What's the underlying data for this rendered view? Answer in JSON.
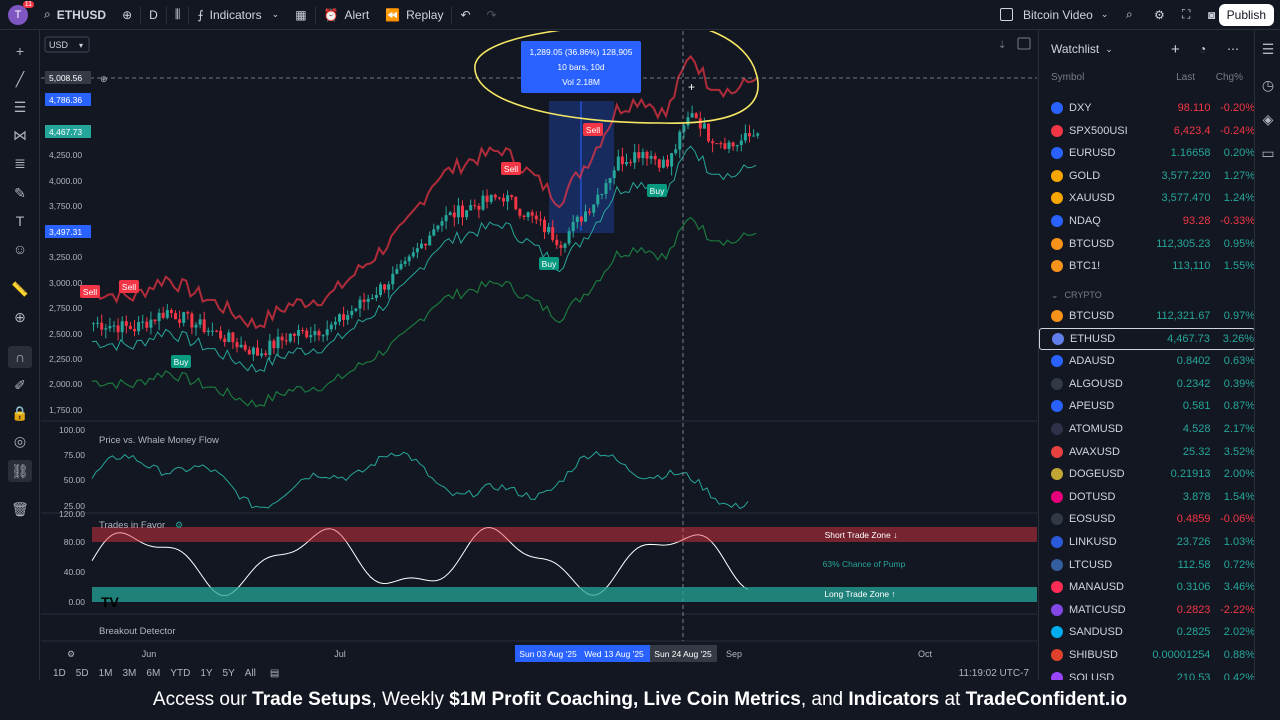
{
  "topbar": {
    "avatar_letter": "T",
    "avatar_badge": "11",
    "symbol": "ETHUSD",
    "interval": "D",
    "indicators_label": "Indicators",
    "alert_label": "Alert",
    "replay_label": "Replay",
    "layout_name": "Bitcoin Video",
    "publish_label": "Publish"
  },
  "chart": {
    "currency": "USD",
    "price_axis": [
      "5,008.56",
      "4,786.36",
      "4,467.73",
      "4,250.00",
      "4,000.00",
      "3,750.00",
      "3,497.31",
      "3,250.00",
      "3,000.00",
      "2,750.00",
      "2,500.00",
      "2,250.00",
      "2,000.00",
      "1,750.00"
    ],
    "measure_tooltip": {
      "line1": "1,289.05 (36.86%) 128,905",
      "line2": "10 bars, 10d",
      "line3": "Vol 2.18M"
    },
    "signals": [
      {
        "label": "Sell",
        "kind": "sell"
      },
      {
        "label": "Sell",
        "kind": "sell"
      },
      {
        "label": "Sell",
        "kind": "sell"
      },
      {
        "label": "Sell",
        "kind": "sell"
      },
      {
        "label": "Buy",
        "kind": "buy"
      },
      {
        "label": "Buy",
        "kind": "buy"
      },
      {
        "label": "Buy",
        "kind": "buy"
      }
    ],
    "pane2": {
      "title": "Price vs. Whale Money Flow",
      "axis": [
        "100.00",
        "75.00",
        "50.00",
        "25.00"
      ]
    },
    "pane3": {
      "title": "Trades in Favor",
      "axis": [
        "120.00",
        "80.00",
        "40.00",
        "0.00"
      ],
      "short_zone": "Short Trade Zone ↓",
      "pump_text": "63% Chance of Pump",
      "long_zone": "Long Trade Zone ↑"
    },
    "pane4": {
      "title": "Breakout Detector"
    },
    "time_axis": [
      "Jun",
      "Jul",
      "Sep",
      "Oct"
    ],
    "time_highlight": [
      "Sun 03 Aug '25",
      "Wed 13 Aug '25",
      "Sun 24 Aug '25"
    ],
    "ranges": [
      "1D",
      "5D",
      "1M",
      "3M",
      "6M",
      "YTD",
      "1Y",
      "5Y",
      "All"
    ],
    "clock": "11:19:02 UTC-7"
  },
  "watchlist": {
    "title": "Watchlist",
    "col_symbol": "Symbol",
    "col_last": "Last",
    "col_chg": "Chg%",
    "section": "CRYPTO",
    "rows_top": [
      {
        "sym": "DXY",
        "last": "98.110",
        "chg": "-0.20%",
        "dir": "dn",
        "color": "#2962ff"
      },
      {
        "sym": "SPX500USI",
        "last": "6,423.4",
        "chg": "-0.24%",
        "dir": "dn",
        "color": "#f23645"
      },
      {
        "sym": "EURUSD",
        "last": "1.16658",
        "chg": "0.20%",
        "dir": "up",
        "color": "#2962ff"
      },
      {
        "sym": "GOLD",
        "last": "3,577.220",
        "chg": "1.27%",
        "dir": "up",
        "color": "#f7a600"
      },
      {
        "sym": "XAUUSD",
        "last": "3,577.470",
        "chg": "1.24%",
        "dir": "up",
        "color": "#f7a600"
      },
      {
        "sym": "NDAQ",
        "last": "93.28",
        "chg": "-0.33%",
        "dir": "dn",
        "color": "#2962ff"
      },
      {
        "sym": "BTCUSD",
        "last": "112,305.23",
        "chg": "0.95%",
        "dir": "up",
        "color": "#f7931a"
      },
      {
        "sym": "BTC1!",
        "last": "113,110",
        "chg": "1.55%",
        "dir": "up",
        "color": "#f7931a"
      }
    ],
    "rows_crypto": [
      {
        "sym": "BTCUSD",
        "last": "112,321.67",
        "chg": "0.97%",
        "dir": "up",
        "color": "#f7931a"
      },
      {
        "sym": "ETHUSD",
        "last": "4,467.73",
        "chg": "3.26%",
        "dir": "up",
        "color": "#627eea"
      },
      {
        "sym": "ADAUSD",
        "last": "0.8402",
        "chg": "0.63%",
        "dir": "up",
        "color": "#2962ff"
      },
      {
        "sym": "ALGOUSD",
        "last": "0.2342",
        "chg": "0.39%",
        "dir": "up",
        "color": "#333a47"
      },
      {
        "sym": "APEUSD",
        "last": "0.581",
        "chg": "0.87%",
        "dir": "up",
        "color": "#2962ff"
      },
      {
        "sym": "ATOMUSD",
        "last": "4.528",
        "chg": "2.17%",
        "dir": "up",
        "color": "#2e3148"
      },
      {
        "sym": "AVAXUSD",
        "last": "25.32",
        "chg": "3.52%",
        "dir": "up",
        "color": "#e84142"
      },
      {
        "sym": "DOGEUSD",
        "last": "0.21913",
        "chg": "2.00%",
        "dir": "up",
        "color": "#c2a633"
      },
      {
        "sym": "DOTUSD",
        "last": "3.878",
        "chg": "1.54%",
        "dir": "up",
        "color": "#e6007a"
      },
      {
        "sym": "EOSUSD",
        "last": "0.4859",
        "chg": "-0.06%",
        "dir": "dn",
        "color": "#333a47"
      },
      {
        "sym": "LINKUSD",
        "last": "23.726",
        "chg": "1.03%",
        "dir": "up",
        "color": "#2a5ada"
      },
      {
        "sym": "LTCUSD",
        "last": "112.58",
        "chg": "0.72%",
        "dir": "up",
        "color": "#345d9d"
      },
      {
        "sym": "MANAUSD",
        "last": "0.3106",
        "chg": "3.46%",
        "dir": "up",
        "color": "#ff2d55"
      },
      {
        "sym": "MATICUSD",
        "last": "0.2823",
        "chg": "-2.22%",
        "dir": "dn",
        "color": "#8247e5"
      },
      {
        "sym": "SANDUSD",
        "last": "0.2825",
        "chg": "2.02%",
        "dir": "up",
        "color": "#00adef"
      },
      {
        "sym": "SHIBUSD",
        "last": "0.00001254",
        "chg": "0.88%",
        "dir": "up",
        "color": "#e0412c"
      },
      {
        "sym": "SOLUSD",
        "last": "210.53",
        "chg": "0.42%",
        "dir": "up",
        "color": "#9945ff"
      }
    ]
  },
  "footer": {
    "p1": "Access our ",
    "b1": "Trade Setups",
    "p2": ", Weekly ",
    "b2": "$1M Profit Coaching, Live Coin Metrics",
    "p3": ", and ",
    "b3": "Indicators",
    "p4": " at ",
    "b4": "TradeConfident.io"
  },
  "colors": {
    "bg": "#131722",
    "up": "#26a69a",
    "down": "#f23645",
    "accent": "#2962ff",
    "annotation": "#f5e663"
  }
}
